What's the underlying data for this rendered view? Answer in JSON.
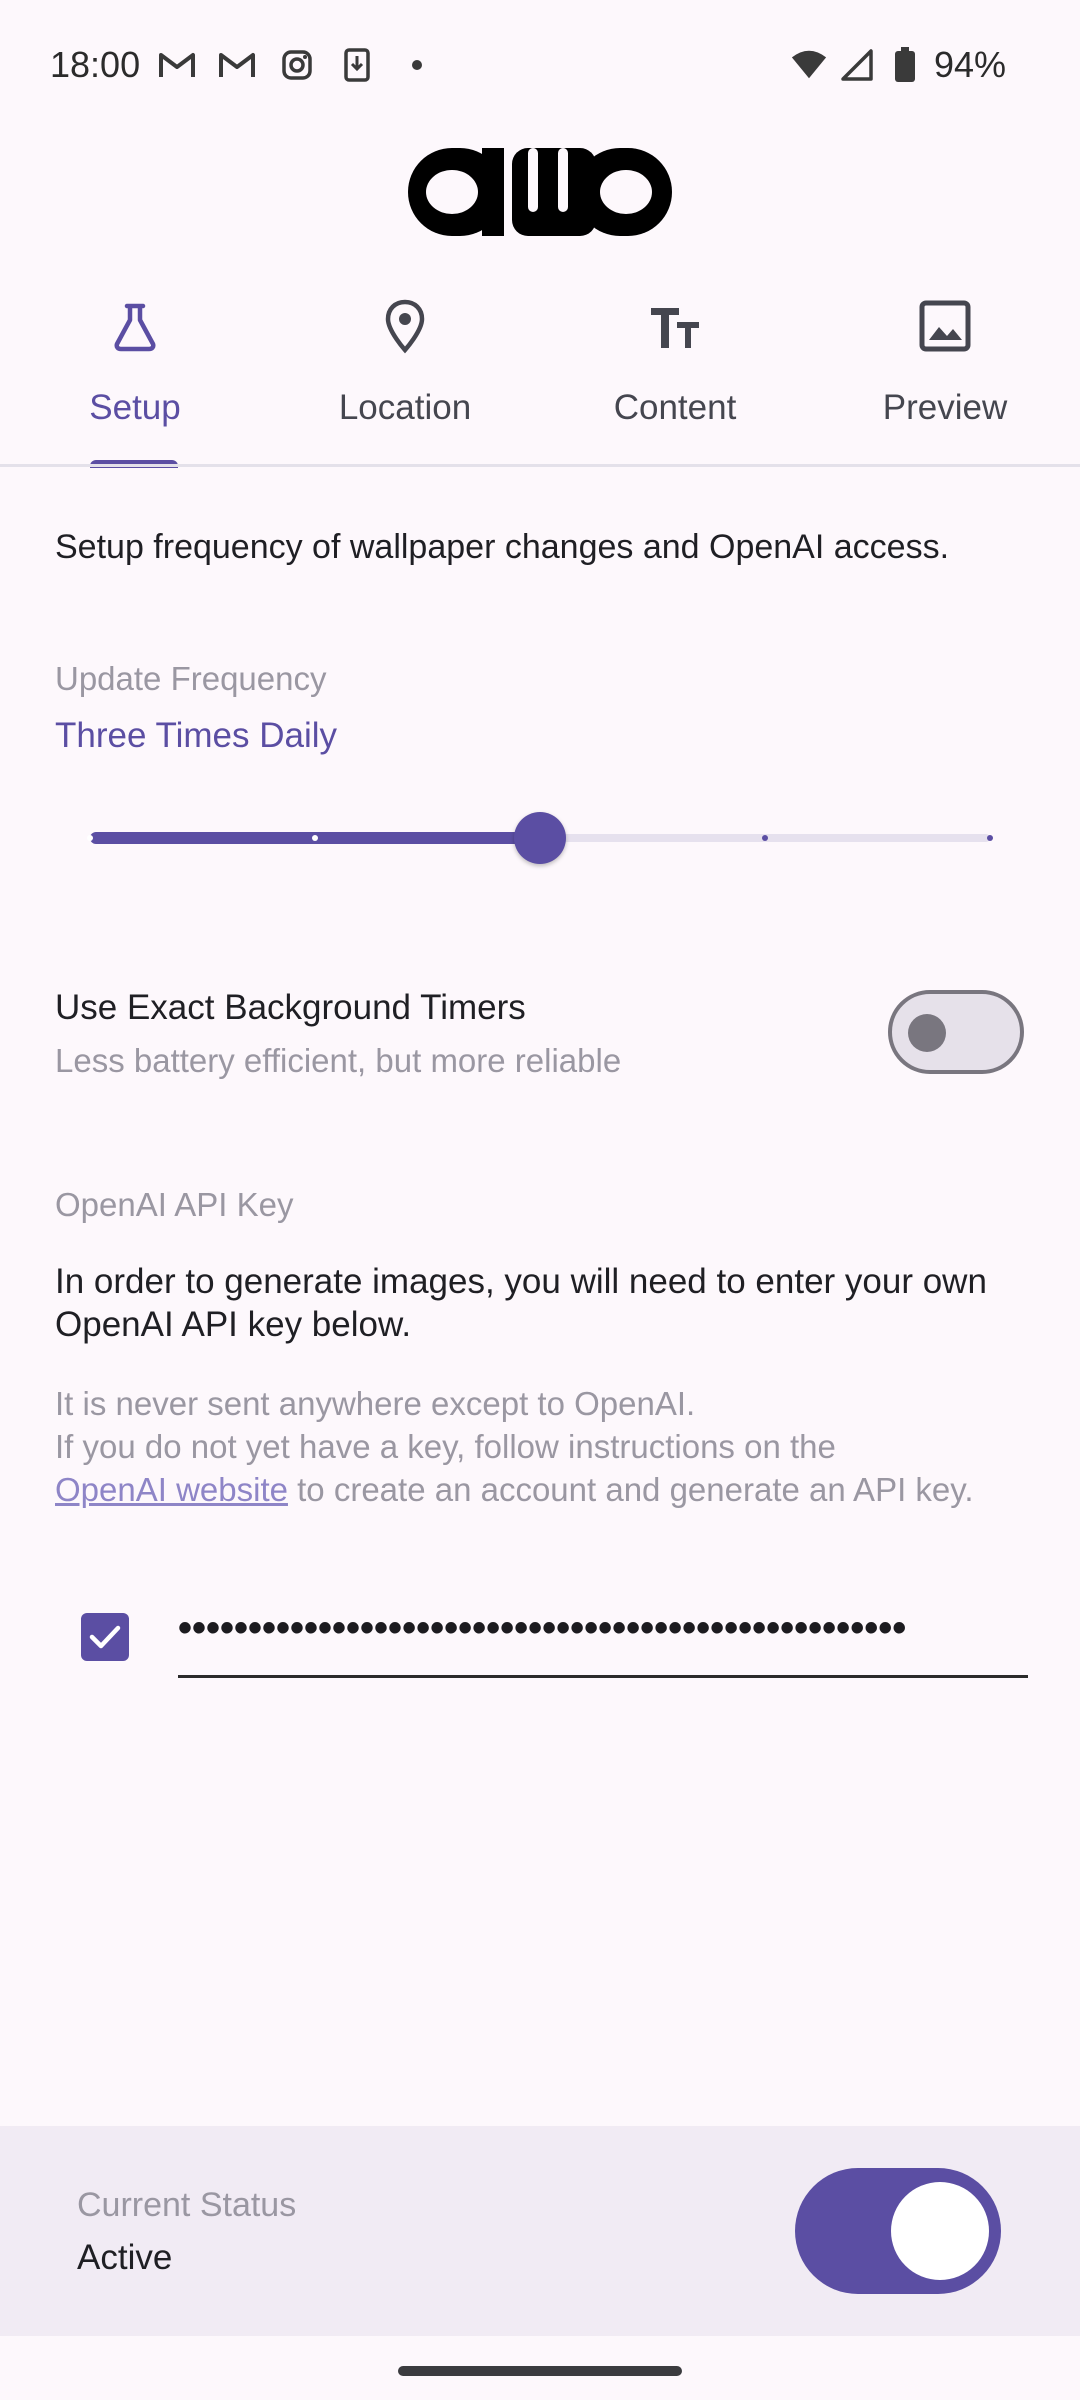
{
  "status_bar": {
    "time": "18:00",
    "battery": "94%",
    "left_icons": [
      "gmail-icon",
      "gmail-icon",
      "instagram-icon",
      "download-icon",
      "dot-icon"
    ],
    "right_icons": [
      "wifi-icon",
      "signal-icon",
      "battery-icon"
    ]
  },
  "tabs": [
    {
      "label": "Setup",
      "icon": "flask-icon",
      "active": true
    },
    {
      "label": "Location",
      "icon": "location-pin-icon",
      "active": false
    },
    {
      "label": "Content",
      "icon": "text-size-icon",
      "active": false
    },
    {
      "label": "Preview",
      "icon": "image-icon",
      "active": false
    }
  ],
  "setup": {
    "intro": "Setup frequency of wallpaper changes and OpenAI access.",
    "update_frequency_label": "Update Frequency",
    "update_frequency_value": "Three Times Daily",
    "slider": {
      "steps": 5,
      "value_index": 2
    },
    "exact_timers": {
      "title": "Use Exact Background Timers",
      "subtitle": "Less battery efficient, but more reliable",
      "enabled": false
    },
    "api_key": {
      "label": "OpenAI API Key",
      "description": "In order to generate images, you will need to enter your own OpenAI API key below.",
      "note_line1": "It is never sent anywhere except to OpenAI.",
      "note_line2": "If you do not yet have a key, follow instructions on the",
      "link_text": "OpenAI website",
      "note_line3": " to create an account and generate an API key.",
      "masked_value": "••••••••••••••••••••••••••••••••••••••••••••••••••••",
      "show_checkbox_checked": true
    }
  },
  "bottom": {
    "status_label": "Current Status",
    "status_value": "Active",
    "active": true
  },
  "colors": {
    "accent": "#5b4ea3",
    "background": "#fdf8fc",
    "muted_text": "#9a97a2",
    "panel": "#f1ebf4"
  }
}
